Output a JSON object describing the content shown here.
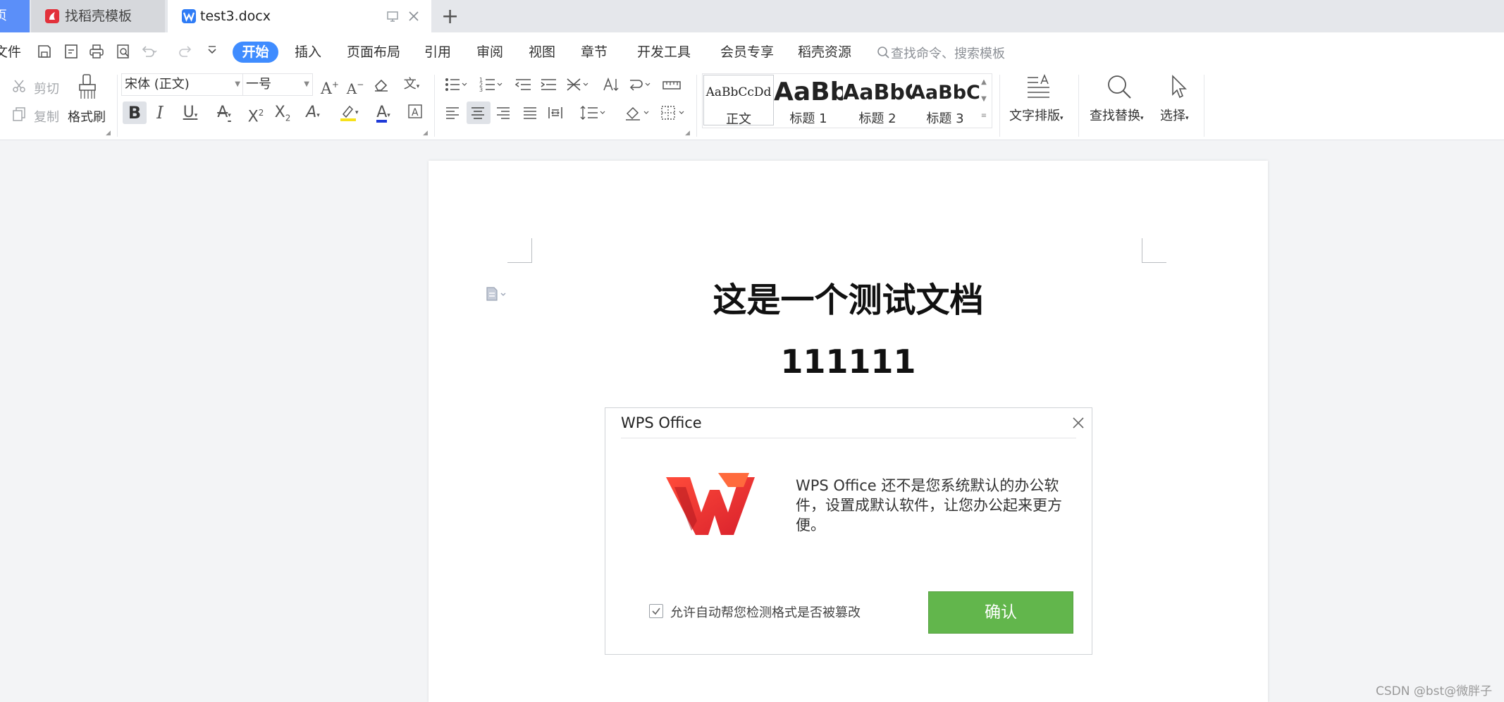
{
  "tabs": {
    "home_label": "页",
    "items": [
      {
        "label": "找稻壳模板"
      },
      {
        "label": "test3.docx"
      }
    ],
    "new_tab_label": "+"
  },
  "menu": {
    "file_label": "文件",
    "active": "开始",
    "items": [
      "插入",
      "页面布局",
      "引用",
      "审阅",
      "视图",
      "章节",
      "开发工具",
      "会员专享",
      "稻壳资源"
    ],
    "search_placeholder": "查找命令、搜索模板"
  },
  "ribbon": {
    "cut": "剪切",
    "copy": "复制",
    "format_painter": "格式刷",
    "font_name": "宋体 (正文)",
    "font_size": "一号",
    "styles": [
      {
        "sample": "AaBbCcDd",
        "name": "正文"
      },
      {
        "sample": "AaBb",
        "name": "标题 1"
      },
      {
        "sample": "AaBbC",
        "name": "标题 2"
      },
      {
        "sample": "AaBbC",
        "name": "标题 3"
      }
    ],
    "text_layout": "文字排版",
    "find_replace": "查找替换",
    "select": "选择"
  },
  "document": {
    "title": "这是一个测试文档",
    "line2": "111111"
  },
  "dialog": {
    "title": "WPS Office",
    "message": "WPS Office 还不是您系统默认的办公软件，设置成默认软件，让您办公起来更方便。",
    "checkbox_label": "允许自动帮您检测格式是否被篡改",
    "checkbox_checked": true,
    "ok_label": "确认"
  },
  "watermark": "CSDN @bst@微胖子",
  "colors": {
    "accent": "#3f8cff",
    "ok_button": "#62b64c",
    "logo_red": "#e8323b"
  }
}
